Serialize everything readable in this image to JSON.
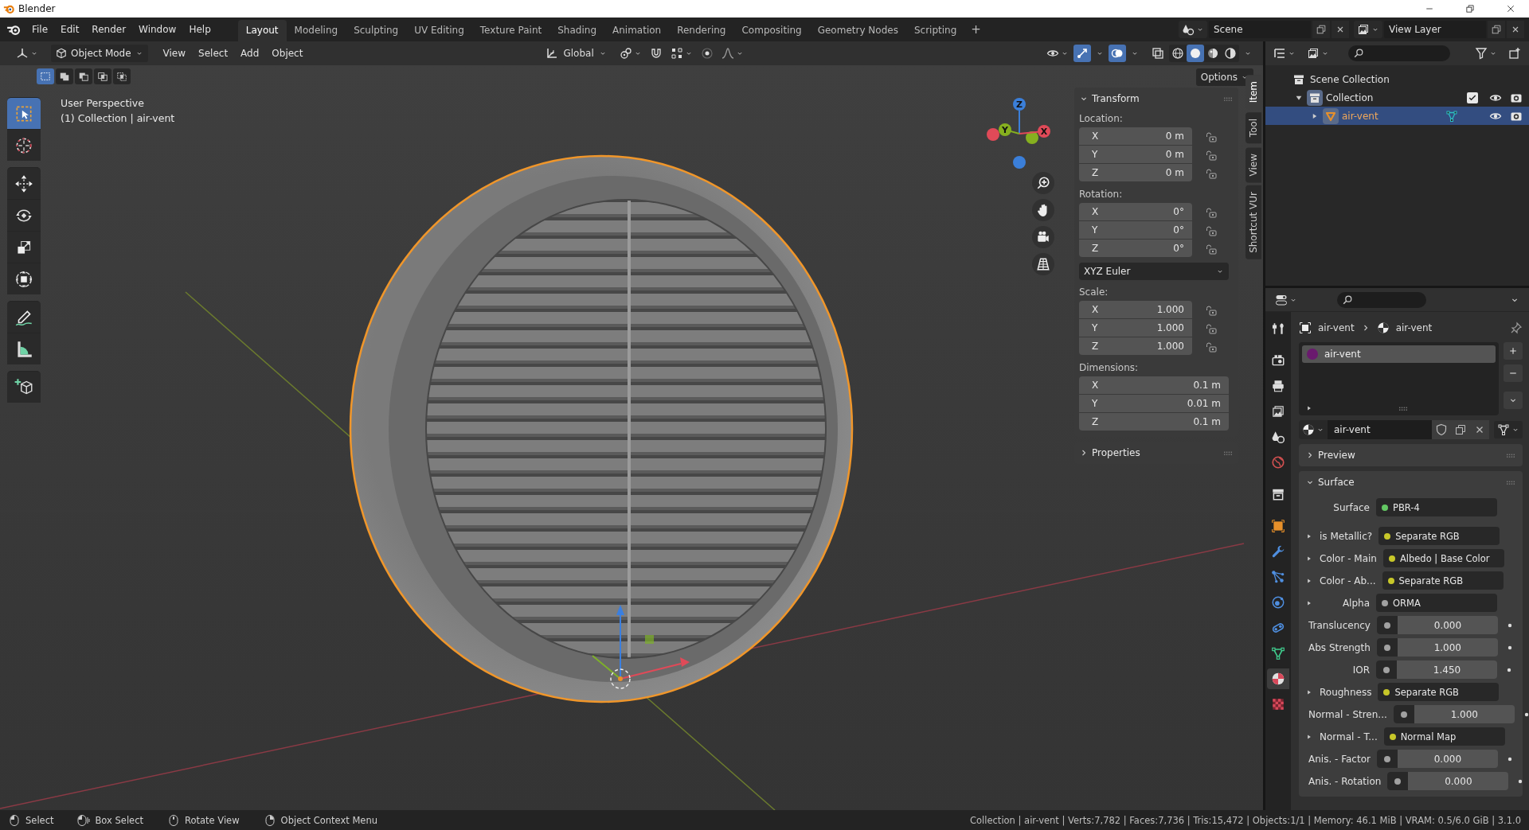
{
  "window": {
    "title": "Blender"
  },
  "menus": [
    "File",
    "Edit",
    "Render",
    "Window",
    "Help"
  ],
  "workspaces": [
    {
      "label": "Layout",
      "selected": true
    },
    {
      "label": "Modeling",
      "selected": false
    },
    {
      "label": "Sculpting",
      "selected": false
    },
    {
      "label": "UV Editing",
      "selected": false
    },
    {
      "label": "Texture Paint",
      "selected": false
    },
    {
      "label": "Shading",
      "selected": false
    },
    {
      "label": "Animation",
      "selected": false
    },
    {
      "label": "Rendering",
      "selected": false
    },
    {
      "label": "Compositing",
      "selected": false
    },
    {
      "label": "Geometry Nodes",
      "selected": false
    },
    {
      "label": "Scripting",
      "selected": false
    }
  ],
  "add_workspace": "+",
  "scene": "Scene",
  "view_layer": "View Layer",
  "viewport_header": {
    "mode": "Object Mode",
    "menus": [
      "View",
      "Select",
      "Add",
      "Object"
    ],
    "orientation": "Global",
    "shading_modes": [
      {
        "kind": "wireframe",
        "selected": false
      },
      {
        "kind": "solid",
        "selected": true
      },
      {
        "kind": "material",
        "selected": false
      },
      {
        "kind": "rendered",
        "selected": false
      }
    ]
  },
  "tool_settings": {
    "select_modes": [
      {
        "kind": "set",
        "selected": true
      },
      {
        "kind": "extend",
        "selected": false
      },
      {
        "kind": "subtract",
        "selected": false
      },
      {
        "kind": "invert",
        "selected": false
      },
      {
        "kind": "intersect",
        "selected": false
      }
    ],
    "options": "Options"
  },
  "viewport": {
    "view_name": "User Perspective",
    "context": "(1) Collection | air-vent"
  },
  "nav_gizmo": [
    {
      "label": "Z",
      "color": "#3b7fd9"
    },
    {
      "label": "Y",
      "color": "#86b01f"
    },
    {
      "label": "X",
      "color": "#e04a58"
    }
  ],
  "toolbar": [
    {
      "kind": "select_box",
      "selected": true
    },
    {
      "kind": "cursor",
      "selected": false
    },
    {
      "kind": "move",
      "selected": false
    },
    {
      "kind": "rotate",
      "selected": false
    },
    {
      "kind": "scale",
      "selected": false
    },
    {
      "kind": "transform",
      "selected": false
    },
    {
      "kind": "annotate",
      "selected": false
    },
    {
      "kind": "measure",
      "selected": false
    },
    {
      "kind": "add_cube",
      "selected": false
    }
  ],
  "sidebar_tabs": [
    {
      "label": "Item",
      "selected": true
    },
    {
      "label": "Tool",
      "selected": false
    },
    {
      "label": "View",
      "selected": false
    },
    {
      "label": "Shortcut VUr",
      "selected": false
    }
  ],
  "transform": {
    "title": "Transform",
    "expanded": true,
    "groups": [
      {
        "label": "Location:",
        "lockable": true,
        "fields": [
          {
            "axis": "X",
            "value": "0 m"
          },
          {
            "axis": "Y",
            "value": "0 m"
          },
          {
            "axis": "Z",
            "value": "0 m"
          }
        ]
      },
      {
        "label": "Rotation:",
        "lockable": true,
        "fields": [
          {
            "axis": "X",
            "value": "0°"
          },
          {
            "axis": "Y",
            "value": "0°"
          },
          {
            "axis": "Z",
            "value": "0°"
          }
        ],
        "mode": "XYZ Euler"
      },
      {
        "label": "Scale:",
        "lockable": true,
        "fields": [
          {
            "axis": "X",
            "value": "1.000"
          },
          {
            "axis": "Y",
            "value": "1.000"
          },
          {
            "axis": "Z",
            "value": "1.000"
          }
        ]
      },
      {
        "label": "Dimensions:",
        "lockable": false,
        "fields": [
          {
            "axis": "X",
            "value": "0.1 m"
          },
          {
            "axis": "Y",
            "value": "0.01 m"
          },
          {
            "axis": "Z",
            "value": "0.1 m"
          }
        ]
      }
    ]
  },
  "properties_section": {
    "title": "Properties",
    "expanded": false
  },
  "outliner": {
    "tree": [
      {
        "label": "Scene Collection",
        "kind": "scene",
        "selected": false,
        "children": [
          {
            "label": "Collection",
            "kind": "collection",
            "selected": false,
            "expanded": true,
            "checked": true,
            "children": [
              {
                "label": "air-vent",
                "kind": "mesh_object",
                "selected": true,
                "expanded": false
              }
            ]
          }
        ]
      }
    ]
  },
  "properties": {
    "tabs": [
      {
        "kind": "tool",
        "selected": false
      },
      {
        "kind": "render",
        "selected": false
      },
      {
        "kind": "output",
        "selected": false
      },
      {
        "kind": "view_layer",
        "selected": false
      },
      {
        "kind": "scene",
        "selected": false
      },
      {
        "kind": "world",
        "selected": false
      },
      {
        "kind": "collection",
        "selected": false
      },
      {
        "kind": "object",
        "selected": false
      },
      {
        "kind": "modifiers",
        "selected": false
      },
      {
        "kind": "particles",
        "selected": false
      },
      {
        "kind": "physics",
        "selected": false
      },
      {
        "kind": "constraints",
        "selected": false
      },
      {
        "kind": "data",
        "selected": false
      },
      {
        "kind": "material",
        "selected": true
      },
      {
        "kind": "texture",
        "selected": false
      }
    ],
    "breadcrumb": [
      "air-vent",
      "air-vent"
    ],
    "material_slots": [
      {
        "name": "air-vent",
        "selected": true,
        "color": "#6a1a6e"
      }
    ],
    "material": "air-vent",
    "panels": [
      {
        "title": "Preview",
        "expanded": false
      },
      {
        "title": "Surface",
        "expanded": true
      }
    ],
    "surface_rows": [
      {
        "label": "Surface",
        "kind": "link",
        "value": "PBR-4",
        "color": "#63c763",
        "expandable": false
      },
      {
        "label": "is Metallic?",
        "kind": "link",
        "value": "Separate RGB",
        "color": "#c7c729",
        "expandable": true
      },
      {
        "label": "Color - Main",
        "kind": "link",
        "value": "Albedo | Base Color",
        "color": "#c7c729",
        "expandable": true
      },
      {
        "label": "Color - Ab...",
        "kind": "link",
        "value": "Separate RGB",
        "color": "#c7c729",
        "expandable": true
      },
      {
        "label": "Alpha",
        "kind": "link",
        "value": "ORMA",
        "color": "#a1a1a1",
        "expandable": true
      },
      {
        "label": "Translucency",
        "kind": "number",
        "value": "0.000",
        "color": "#a1a1a1",
        "expandable": false
      },
      {
        "label": "Abs Strength",
        "kind": "number",
        "value": "1.000",
        "color": "#a1a1a1",
        "expandable": false
      },
      {
        "label": "IOR",
        "kind": "number",
        "value": "1.450",
        "color": "#a1a1a1",
        "expandable": false
      },
      {
        "label": "Roughness",
        "kind": "link",
        "value": "Separate RGB",
        "color": "#c7c729",
        "expandable": true
      },
      {
        "label": "Normal - Stren...",
        "kind": "number",
        "value": "1.000",
        "color": "#a1a1a1",
        "expandable": false
      },
      {
        "label": "Normal - T...",
        "kind": "link",
        "value": "Normal Map",
        "color": "#c7c729",
        "expandable": true
      },
      {
        "label": "Anis. - Factor",
        "kind": "number",
        "value": "0.000",
        "color": "#a1a1a1",
        "expandable": false
      },
      {
        "label": "Anis. - Rotation",
        "kind": "number",
        "value": "0.000",
        "color": "#a1a1a1",
        "expandable": false
      }
    ]
  },
  "status_bar": {
    "hints": [
      {
        "kind": "left_click",
        "label": "Select"
      },
      {
        "kind": "drag",
        "label": "Box Select"
      },
      {
        "kind": "middle_click",
        "label": "Rotate View"
      },
      {
        "kind": "right_click",
        "label": "Object Context Menu"
      }
    ],
    "info": "Collection | air-vent | Verts:7,782 | Faces:7,736 | Tris:15,472 | Objects:1/1 | Memory: 46.1 MiB | VRAM: 0.5/6.0 GiB | 3.1.0"
  }
}
